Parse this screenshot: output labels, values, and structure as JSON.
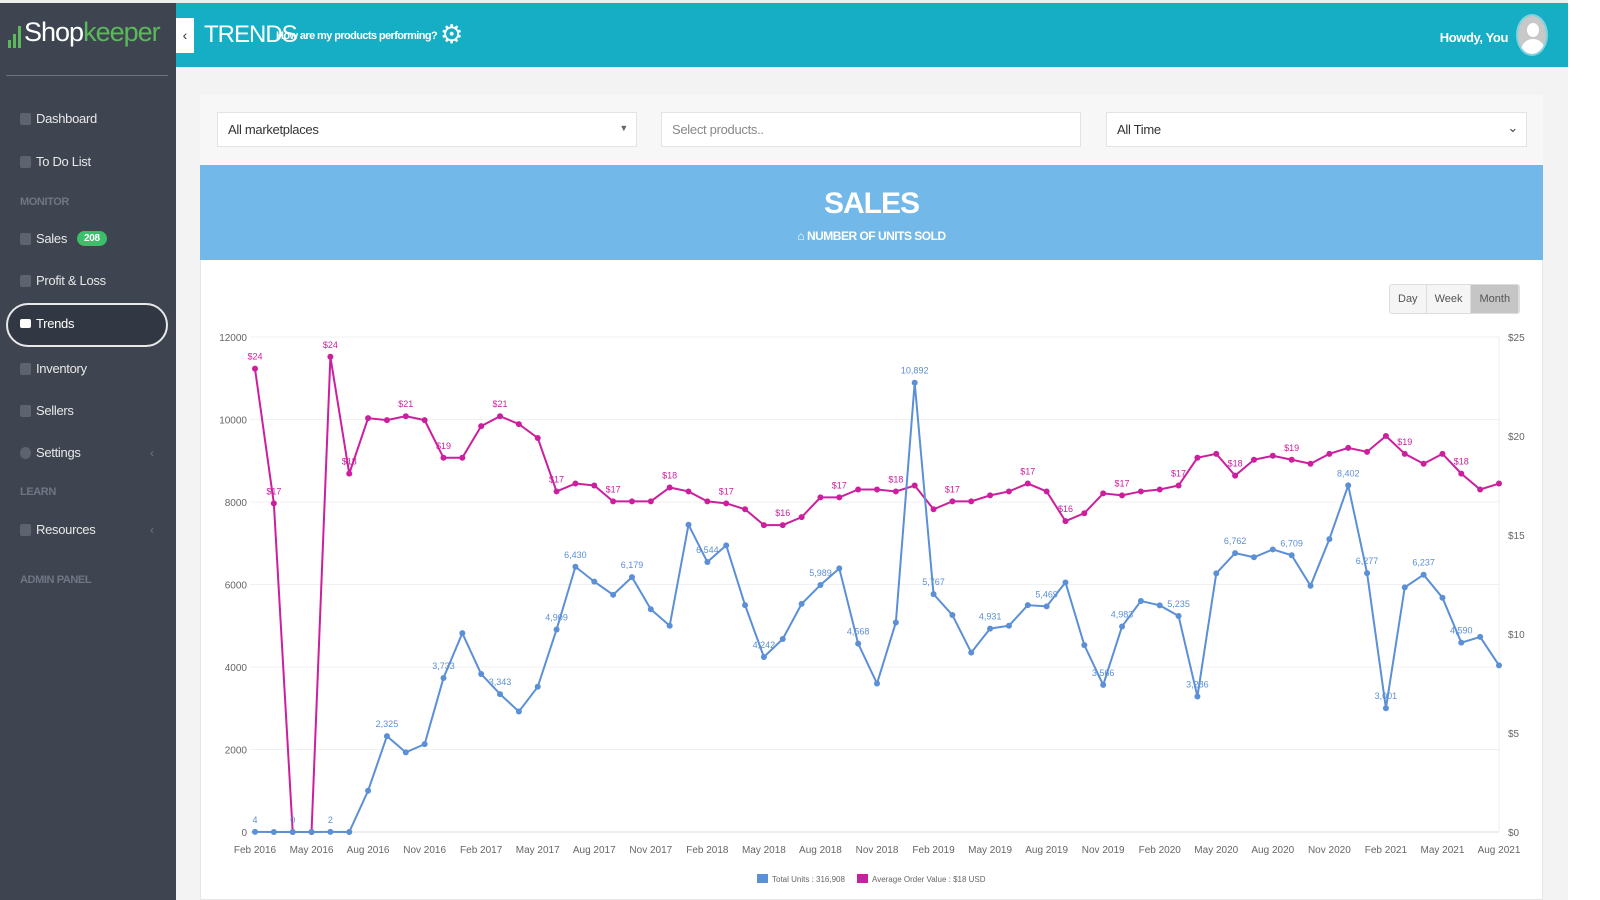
{
  "sidebar": {
    "logo": {
      "part1": "Shop",
      "part2": "keeper"
    },
    "items": [
      {
        "label": "Dashboard"
      },
      {
        "label": "To Do List"
      },
      {
        "section": "MONITOR"
      },
      {
        "label": "Sales",
        "badge": "208"
      },
      {
        "label": "Profit & Loss"
      },
      {
        "label": "Trends",
        "active": true
      },
      {
        "label": "Inventory"
      },
      {
        "label": "Sellers"
      },
      {
        "label": "Settings"
      },
      {
        "section": "LEARN"
      },
      {
        "label": "Resources"
      },
      {
        "section": "ADMIN PANEL"
      }
    ]
  },
  "header": {
    "title": "TRENDS",
    "subtitle": "How are my products performing?",
    "greeting": "Howdy, You"
  },
  "filters": {
    "marketplace": "All marketplaces",
    "products_placeholder": "Select products..",
    "time_range": "All Time"
  },
  "banner": {
    "title": "SALES",
    "subtitle": "NUMBER OF UNITS SOLD"
  },
  "period": {
    "options": [
      "Day",
      "Week",
      "Month"
    ],
    "selected": "Month"
  },
  "colors": {
    "units": "#5b8fd6",
    "aov": "#cc1f9e",
    "header": "#16aec4",
    "banner": "#72b8e8",
    "sidebar": "#3e4551"
  },
  "chart_data": {
    "type": "line",
    "x_tick_labels": [
      "Feb 2016",
      "May 2016",
      "Aug 2016",
      "Nov 2016",
      "Feb 2017",
      "May 2017",
      "Aug 2017",
      "Nov 2017",
      "Feb 2018",
      "May 2018",
      "Aug 2018",
      "Nov 2018",
      "Feb 2019",
      "May 2019",
      "Aug 2019",
      "Nov 2019",
      "Feb 2020",
      "May 2020",
      "Aug 2020",
      "Nov 2020",
      "Feb 2021",
      "May 2021",
      "Aug 2021"
    ],
    "x_start": "Feb 2016",
    "x_end": "Aug 2021",
    "y_left": {
      "min": 0,
      "max": 12000,
      "ticks": [
        "0",
        "2000",
        "4000",
        "6000",
        "8000",
        "10000",
        "12000"
      ]
    },
    "y_right": {
      "min": 0,
      "max": 25,
      "ticks": [
        "$0",
        "$5",
        "$10",
        "$15",
        "$20",
        "$25"
      ]
    },
    "grid": true,
    "legend_position": "bottom",
    "series": [
      {
        "name": "Total Units : 316,908",
        "axis": "left",
        "values": [
          4,
          0,
          0,
          0,
          2,
          0,
          1000,
          2325,
          1930,
          2130,
          3733,
          4820,
          3830,
          3343,
          2920,
          3520,
          4909,
          6430,
          6070,
          5750,
          6179,
          5400,
          5000,
          7450,
          6544,
          6950,
          5500,
          4242,
          4680,
          5530,
          5989,
          6390,
          4568,
          3600,
          5080,
          10892,
          5767,
          5260,
          4350,
          4931,
          5000,
          5500,
          5469,
          6050,
          4530,
          3566,
          4983,
          5600,
          5495,
          5235,
          3286,
          6270,
          6762,
          6660,
          6850,
          6709,
          5970,
          7100,
          8402,
          6277,
          3001,
          5930,
          6237,
          5680,
          4590,
          4730,
          4040
        ],
        "labels": [
          "4",
          null,
          "0",
          null,
          "2",
          null,
          null,
          "2,325",
          null,
          null,
          "3,733",
          null,
          null,
          "3,343",
          null,
          null,
          "4,909",
          "6,430",
          null,
          null,
          "6,179",
          null,
          null,
          null,
          "6,544",
          null,
          null,
          "4,242",
          null,
          null,
          "5,989",
          null,
          "4,568",
          null,
          null,
          "10,892",
          "5,767",
          null,
          null,
          "4,931",
          null,
          null,
          "5,469",
          null,
          null,
          "3,566",
          "4,983",
          null,
          null,
          "5,235",
          "3,286",
          null,
          "6,762",
          null,
          null,
          "6,709",
          null,
          null,
          "8,402",
          "6,277",
          "3,001",
          null,
          "6,237",
          null,
          "4,590",
          null,
          null
        ]
      },
      {
        "name": "Average Order Value : $18 USD",
        "axis": "right",
        "values": [
          23.4,
          16.6,
          0,
          0,
          24.0,
          18.1,
          20.9,
          20.8,
          21.0,
          20.8,
          18.9,
          18.9,
          20.5,
          21.0,
          20.6,
          19.9,
          17.2,
          17.6,
          17.5,
          16.7,
          16.7,
          16.7,
          17.4,
          17.2,
          16.7,
          16.6,
          16.3,
          15.5,
          15.5,
          15.9,
          16.9,
          16.9,
          17.3,
          17.3,
          17.2,
          17.5,
          16.3,
          16.7,
          16.7,
          17.0,
          17.2,
          17.6,
          17.2,
          15.7,
          16.1,
          17.1,
          17.0,
          17.2,
          17.3,
          17.5,
          18.9,
          19.1,
          18.0,
          18.8,
          19.0,
          18.8,
          18.6,
          19.1,
          19.4,
          19.2,
          20.0,
          19.1,
          18.6,
          19.1,
          18.1,
          17.3,
          17.6
        ],
        "labels": [
          "$24",
          "$17",
          null,
          null,
          "$24",
          "$18",
          null,
          null,
          "$21",
          null,
          "$19",
          null,
          null,
          "$21",
          null,
          null,
          "$17",
          null,
          null,
          "$17",
          null,
          null,
          "$18",
          null,
          null,
          "$17",
          null,
          null,
          "$16",
          null,
          null,
          "$17",
          null,
          null,
          "$18",
          null,
          null,
          "$17",
          null,
          null,
          null,
          "$17",
          null,
          "$16",
          null,
          null,
          "$17",
          null,
          null,
          "$17",
          null,
          null,
          "$18",
          null,
          null,
          "$19",
          null,
          null,
          null,
          null,
          null,
          "$19",
          null,
          null,
          "$18",
          null,
          null
        ]
      }
    ]
  }
}
